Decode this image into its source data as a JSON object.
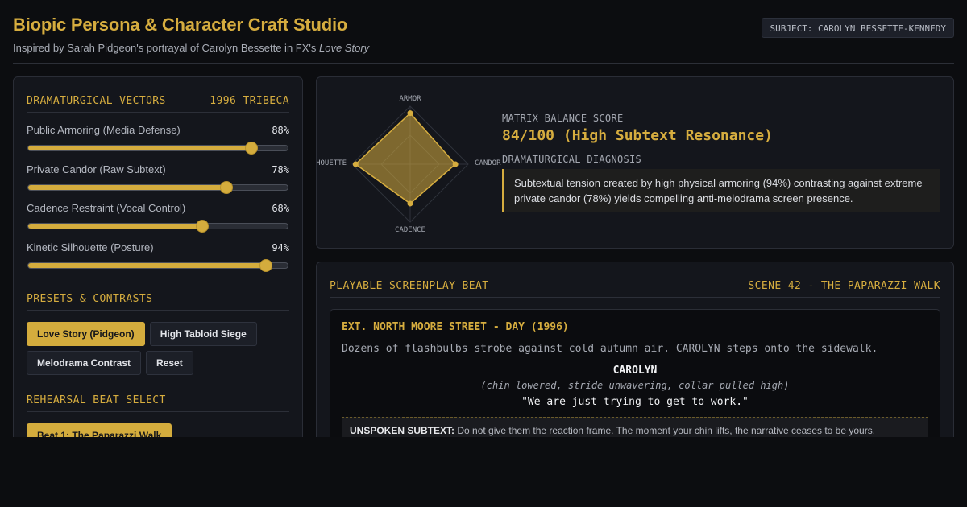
{
  "header": {
    "title": "Biopic Persona & Character Craft Studio",
    "subtitle_prefix": "Inspired by Sarah Pidgeon's portrayal of Carolyn Bessette in FX's ",
    "subtitle_show": "Love Story",
    "subject_badge": "SUBJECT: CAROLYN BESSETTE-KENNEDY"
  },
  "vectors": {
    "heading": "DRAMATURGICAL VECTORS",
    "era": "1996 TRIBECA",
    "sliders": [
      {
        "label": "Public Armoring (Media Defense)",
        "value_text": "88%",
        "value": 88
      },
      {
        "label": "Private Candor (Raw Subtext)",
        "value_text": "78%",
        "value": 78
      },
      {
        "label": "Cadence Restraint (Vocal Control)",
        "value_text": "68%",
        "value": 68
      },
      {
        "label": "Kinetic Silhouette (Posture)",
        "value_text": "94%",
        "value": 94
      }
    ]
  },
  "presets": {
    "heading": "PRESETS & CONTRASTS",
    "buttons": [
      "Love Story (Pidgeon)",
      "High Tabloid Siege",
      "Melodrama Contrast",
      "Reset"
    ],
    "active": 0
  },
  "rehearsal": {
    "heading": "REHEARSAL BEAT SELECT",
    "beat_button": "Beat 1: The Paparazzi Walk"
  },
  "radar": {
    "axes": [
      "ARMOR",
      "CANDOR",
      "CADENCE",
      "SILHOUETTE"
    ],
    "values": [
      88,
      78,
      68,
      94
    ],
    "accent": "#d6ad3f"
  },
  "matrix": {
    "score_label": "MATRIX BALANCE SCORE",
    "score_value": "84/100 (High Subtext Resonance)",
    "diagnosis_label": "DRAMATURGICAL DIAGNOSIS",
    "diagnosis_text": "Subtextual tension created by high physical armoring (94%) contrasting against extreme private candor (78%) yields compelling anti-melodrama screen presence."
  },
  "beat": {
    "heading": "PLAYABLE SCREENPLAY BEAT",
    "scene": "SCENE 42 - THE PAPARAZZI WALK",
    "slugline": "EXT. NORTH MOORE STREET - DAY (1996)",
    "action": "Dozens of flashbulbs strobe against cold autumn air. CAROLYN steps onto the sidewalk.",
    "character": "CAROLYN",
    "parenthetical": "(chin lowered, stride unwavering, collar pulled high)",
    "dialogue": "\"We are just trying to get to work.\"",
    "subtext_label": "UNSPOKEN SUBTEXT:",
    "subtext_text": " Do not give them the reaction frame. The moment your chin lifts, the narrative ceases to be yours."
  }
}
